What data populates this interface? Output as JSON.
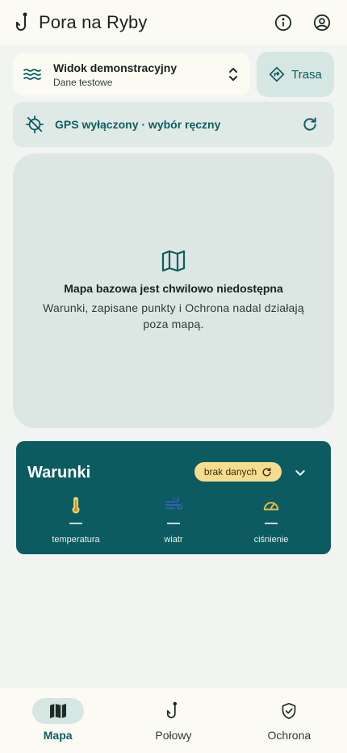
{
  "app": {
    "title": "Pora na Ryby"
  },
  "region": {
    "name": "Widok demonstracyjny",
    "subtitle": "Dane testowe"
  },
  "route": {
    "label": "Trasa"
  },
  "gps": {
    "status": "GPS wyłączony · wybór ręczny"
  },
  "map": {
    "headline": "Mapa bazowa jest chwilowo niedostępna",
    "body": "Warunki, zapisane punkty i Ochrona nadal działają poza mapą."
  },
  "conditions": {
    "title": "Warunki",
    "badge": "brak danych",
    "metrics": [
      {
        "value": "—",
        "label": "temperatura",
        "icon": "thermometer-icon"
      },
      {
        "value": "—",
        "label": "wiatr",
        "icon": "wind-icon"
      },
      {
        "value": "—",
        "label": "ciśnienie",
        "icon": "gauge-icon"
      }
    ]
  },
  "nav": [
    {
      "label": "Mapa",
      "icon": "map-icon",
      "active": true
    },
    {
      "label": "Połowy",
      "icon": "hook-icon",
      "active": false
    },
    {
      "label": "Ochrona",
      "icon": "shield-check-icon",
      "active": false
    }
  ],
  "colors": {
    "accent": "#0e5d61",
    "conditions_card": "#0c5b60",
    "badge": "#f6dc8e",
    "thermometer": "#f2cf6b",
    "wind": "#2f5fb3",
    "gauge": "#e7b84a"
  }
}
